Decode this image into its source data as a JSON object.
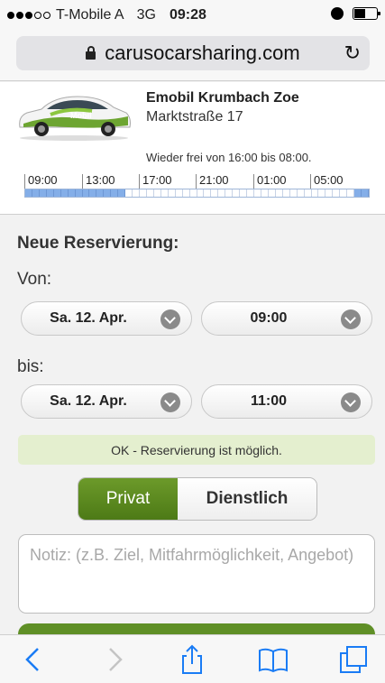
{
  "status_bar": {
    "carrier": "T-Mobile A",
    "network": "3G",
    "time": "09:28"
  },
  "browser": {
    "url": "carusocarsharing.com"
  },
  "car": {
    "name": "Emobil Krumbach Zoe",
    "address": "Marktstraße 17",
    "availability": "Wieder frei von 16:00 bis 08:00.",
    "timeline_labels": [
      "09:00",
      "13:00",
      "17:00",
      "21:00",
      "01:00",
      "05:00"
    ]
  },
  "reservation": {
    "heading": "Neue Reservierung:",
    "from_label": "Von:",
    "from_date": "Sa. 12. Apr.",
    "from_time": "09:00",
    "to_label": "bis:",
    "to_date": "Sa. 12. Apr.",
    "to_time": "11:00",
    "status_message": "OK - Reservierung ist möglich.",
    "type_private": "Privat",
    "type_business": "Dienstlich",
    "note_placeholder": "Notiz: (z.B. Ziel, Mitfahrmöglichkeit, Angebot)"
  },
  "colors": {
    "accent_green": "#5f8f26",
    "ok_background": "#e4efcf",
    "timeline_busy": "#84aee8",
    "ios_blue": "#1a7cf5"
  }
}
